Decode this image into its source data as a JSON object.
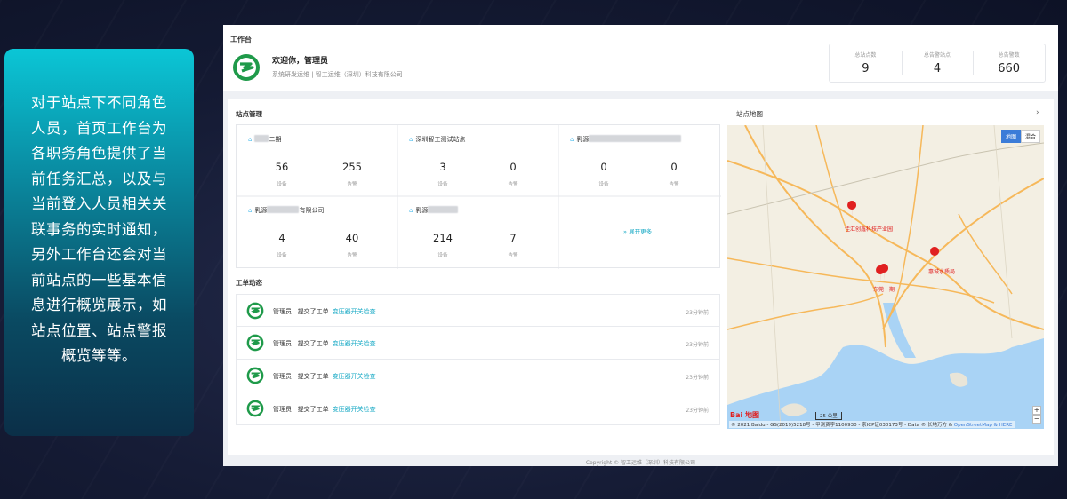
{
  "intro_text": "对于站点下不同角色人员，首页工作台为各职务角色提供了当前任务汇总，以及与当前登入人员相关关联事务的实时通知，另外工作台还会对当前站点的一些基本信息进行概览展示，如站点位置、站点警报概览等等。",
  "header": {
    "breadcrumb": "工作台",
    "welcome": "欢迎你，管理员",
    "subinfo": "系统研发运维 | 智工运维（深圳）科技有限公司",
    "stats": [
      {
        "label": "总站点数",
        "value": "9"
      },
      {
        "label": "总告警站点",
        "value": "4"
      },
      {
        "label": "总告警数",
        "value": "660"
      }
    ]
  },
  "site_section": {
    "title": "站点管理",
    "device_label": "设备",
    "alarm_label": "告警",
    "sites": [
      {
        "name": "二期",
        "devices": "56",
        "alarms": "255"
      },
      {
        "name": "深圳智工测试站点",
        "devices": "3",
        "alarms": "0"
      },
      {
        "name": "乳源",
        "devices": "0",
        "alarms": "0"
      },
      {
        "name": "乳源",
        "name_suffix": "有限公司",
        "devices": "4",
        "alarms": "40"
      },
      {
        "name": "乳源",
        "devices": "214",
        "alarms": "7"
      }
    ],
    "expand_label": "展开更多"
  },
  "work_orders": {
    "title": "工单动态",
    "items": [
      {
        "user": "管理员",
        "action": "提交了工单",
        "task": "变压器开关检查",
        "time": "23分钟前"
      },
      {
        "user": "管理员",
        "action": "提交了工单",
        "task": "变压器开关检查",
        "time": "23分钟前"
      },
      {
        "user": "管理员",
        "action": "提交了工单",
        "task": "变压器开关检查",
        "time": "23分钟前"
      },
      {
        "user": "管理员",
        "action": "提交了工单",
        "task": "变压器开关检查",
        "time": "23分钟前"
      }
    ]
  },
  "map": {
    "title": "站点地图",
    "tabs": [
      "地图",
      "混合"
    ],
    "markers": [
      {
        "label": "佳汇创鑫科技产业园"
      },
      {
        "label": "惠城水质局"
      },
      {
        "label": "东莞一期"
      }
    ],
    "scale": "25 公里",
    "logo": "Bai 地图",
    "attribution": "© 2021 Baidu - GS(2019)5218号 - 甲测资字1100930 - 京ICP证030173号 - Data © 长地万方 & ",
    "attribution_link": "OpenStreetMap & HERE",
    "colors": {
      "water": "#a9d3f5",
      "land": "#f3efe3",
      "road": "#f6b85a",
      "marker": "#e02020"
    }
  },
  "footer": "Copyright © 智工运维（深圳）科技有限公司"
}
